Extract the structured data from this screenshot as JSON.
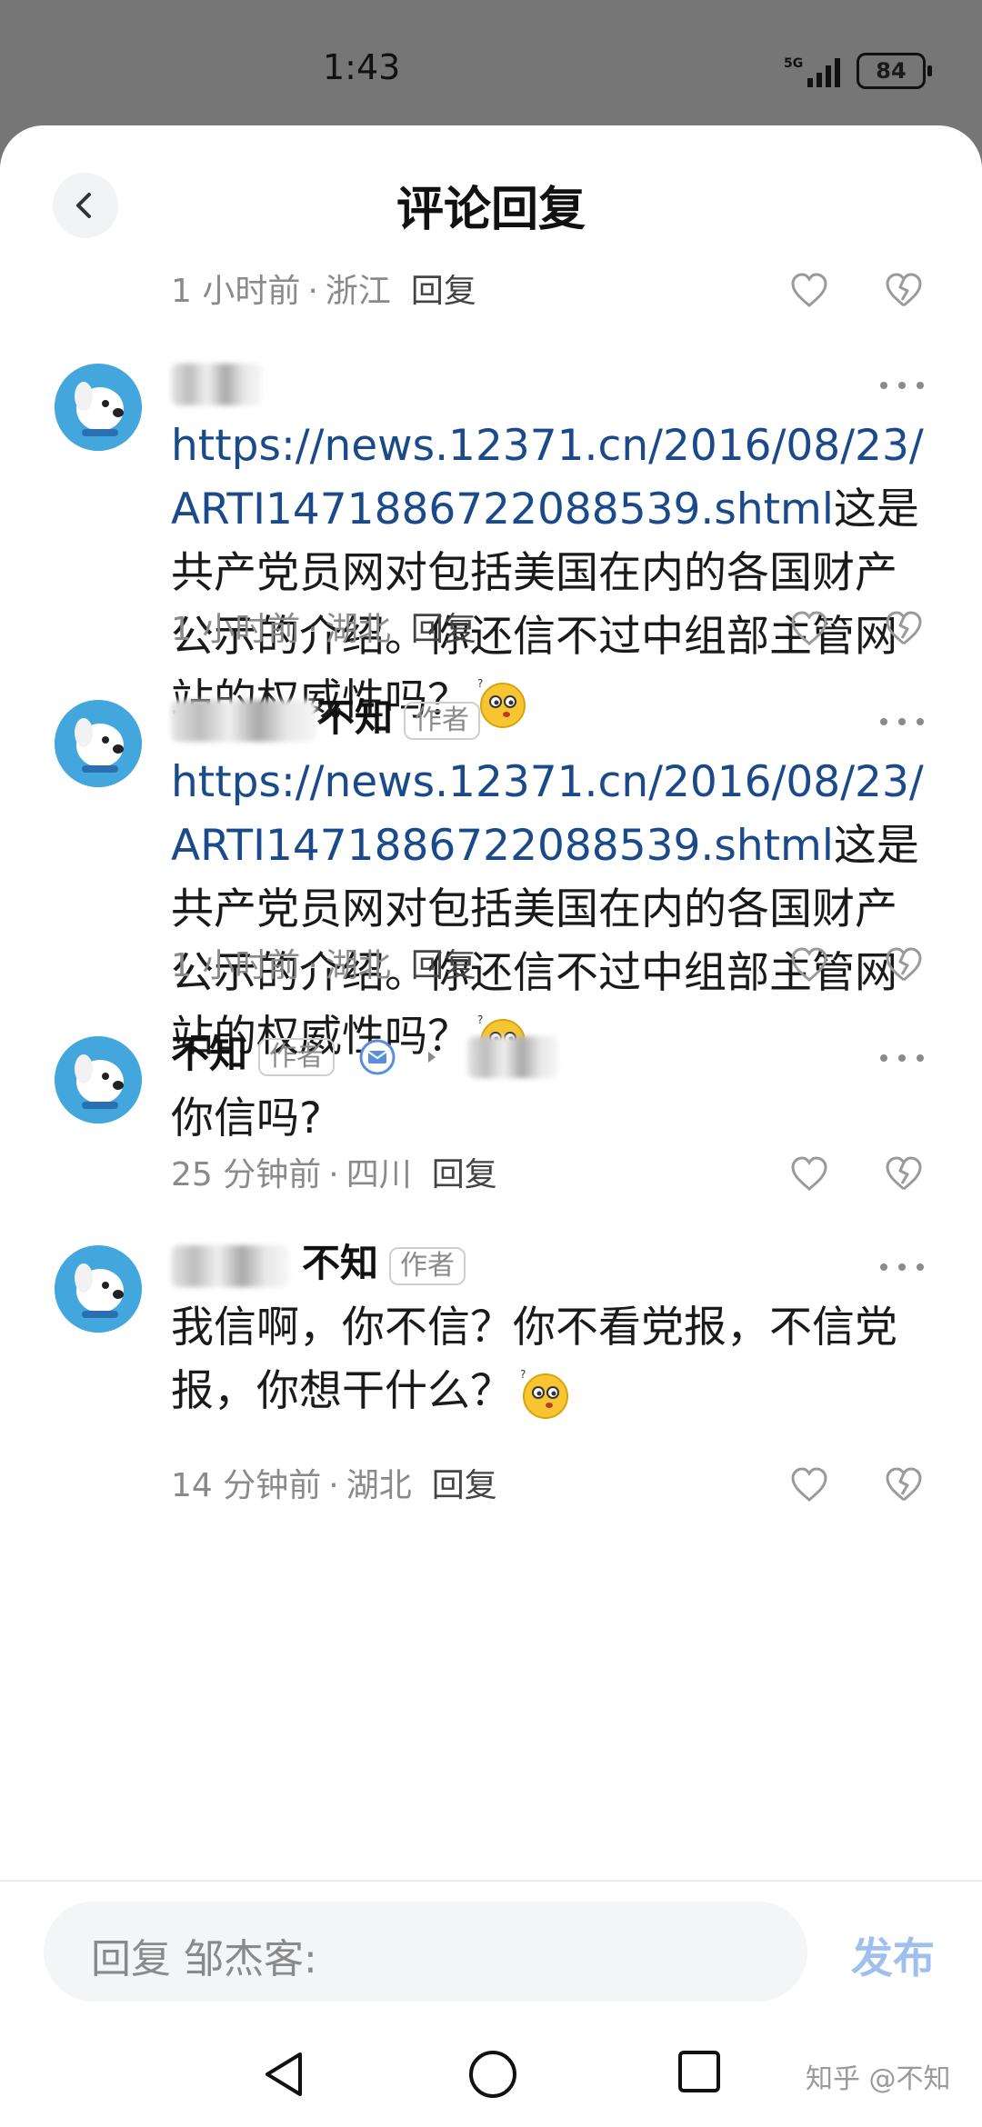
{
  "status_bar": {
    "time": "1:43",
    "network": "5G",
    "battery": "84"
  },
  "header": {
    "title": "评论回复"
  },
  "top_meta": {
    "time": "1 小时前",
    "location": "浙江",
    "reply": "回复"
  },
  "comments": [
    {
      "author_suffix": "",
      "text_link": "https://news.12371.cn/2016/08/23/ARTI1471886722088539.shtml",
      "text": "这是共产党员网对包括美国在内的各国财产公示的介绍。你还信不过中组部主管网站的权威性吗？",
      "time": "1 小时前",
      "location": "湖北",
      "reply": "回复"
    },
    {
      "author_suffix": "不知",
      "author_tag": "作者",
      "text_link": "https://news.12371.cn/2016/08/23/ARTI1471886722088539.shtml",
      "text": "这是共产党员网对包括美国在内的各国财产公示的介绍。你还信不过中组部主管网站的权威性吗？",
      "time": "1 小时前",
      "location": "湖北",
      "reply": "回复"
    },
    {
      "author": "不知",
      "author_tag": "作者",
      "text": "你信吗?",
      "time": "25 分钟前",
      "location": "四川",
      "reply": "回复"
    },
    {
      "author_suffix": "不知",
      "author_tag": "作者",
      "text": "我信啊，你不信？你不看党报，不信党报，你想干什么？",
      "time": "14 分钟前",
      "location": "湖北",
      "reply": "回复"
    }
  ],
  "composer": {
    "placeholder": "回复 邹杰客:",
    "publish": "发布"
  },
  "watermark": "知乎 @不知",
  "colors": {
    "link": "#1a4a8a",
    "publish": "#9fc0ee",
    "avatar": "#43a6dd"
  }
}
